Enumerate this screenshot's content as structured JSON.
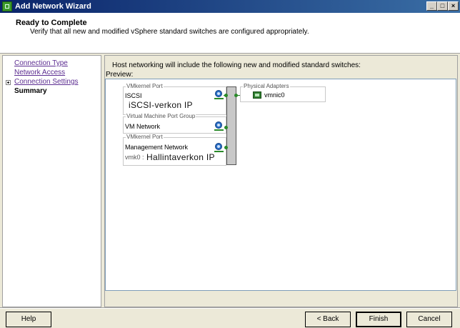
{
  "window": {
    "title": "Add Network Wizard"
  },
  "header": {
    "title": "Ready to Complete",
    "subtitle": "Verify that all new and modified vSphere standard switches are configured appropriately."
  },
  "nav": {
    "items": [
      {
        "label": "Connection Type"
      },
      {
        "label": "Network Access"
      },
      {
        "label": "Connection Settings"
      },
      {
        "label": "Summary"
      }
    ]
  },
  "main": {
    "info": "Host networking will include the following new and modified standard switches:",
    "preview_label": "Preview:",
    "port_groups": [
      {
        "type": "VMkernel Port",
        "name": "ISCSI",
        "note": "iSCSI-verkon IP"
      },
      {
        "type": "Virtual Machine Port Group",
        "name": "VM Network"
      },
      {
        "type": "VMkernel Port",
        "name": "Management Network",
        "vmk": "vmk0 :",
        "note": "Hallintaverkon IP"
      }
    ],
    "physical": {
      "title": "Physical Adapters",
      "adapter": "vmnic0"
    }
  },
  "buttons": {
    "help": "Help",
    "back": "< Back",
    "finish": "Finish",
    "cancel": "Cancel"
  },
  "icons": {
    "portgroup": "network-port-icon",
    "nic": "nic-icon",
    "window_controls": [
      "minimize-icon",
      "maximize-icon",
      "close-icon"
    ]
  }
}
